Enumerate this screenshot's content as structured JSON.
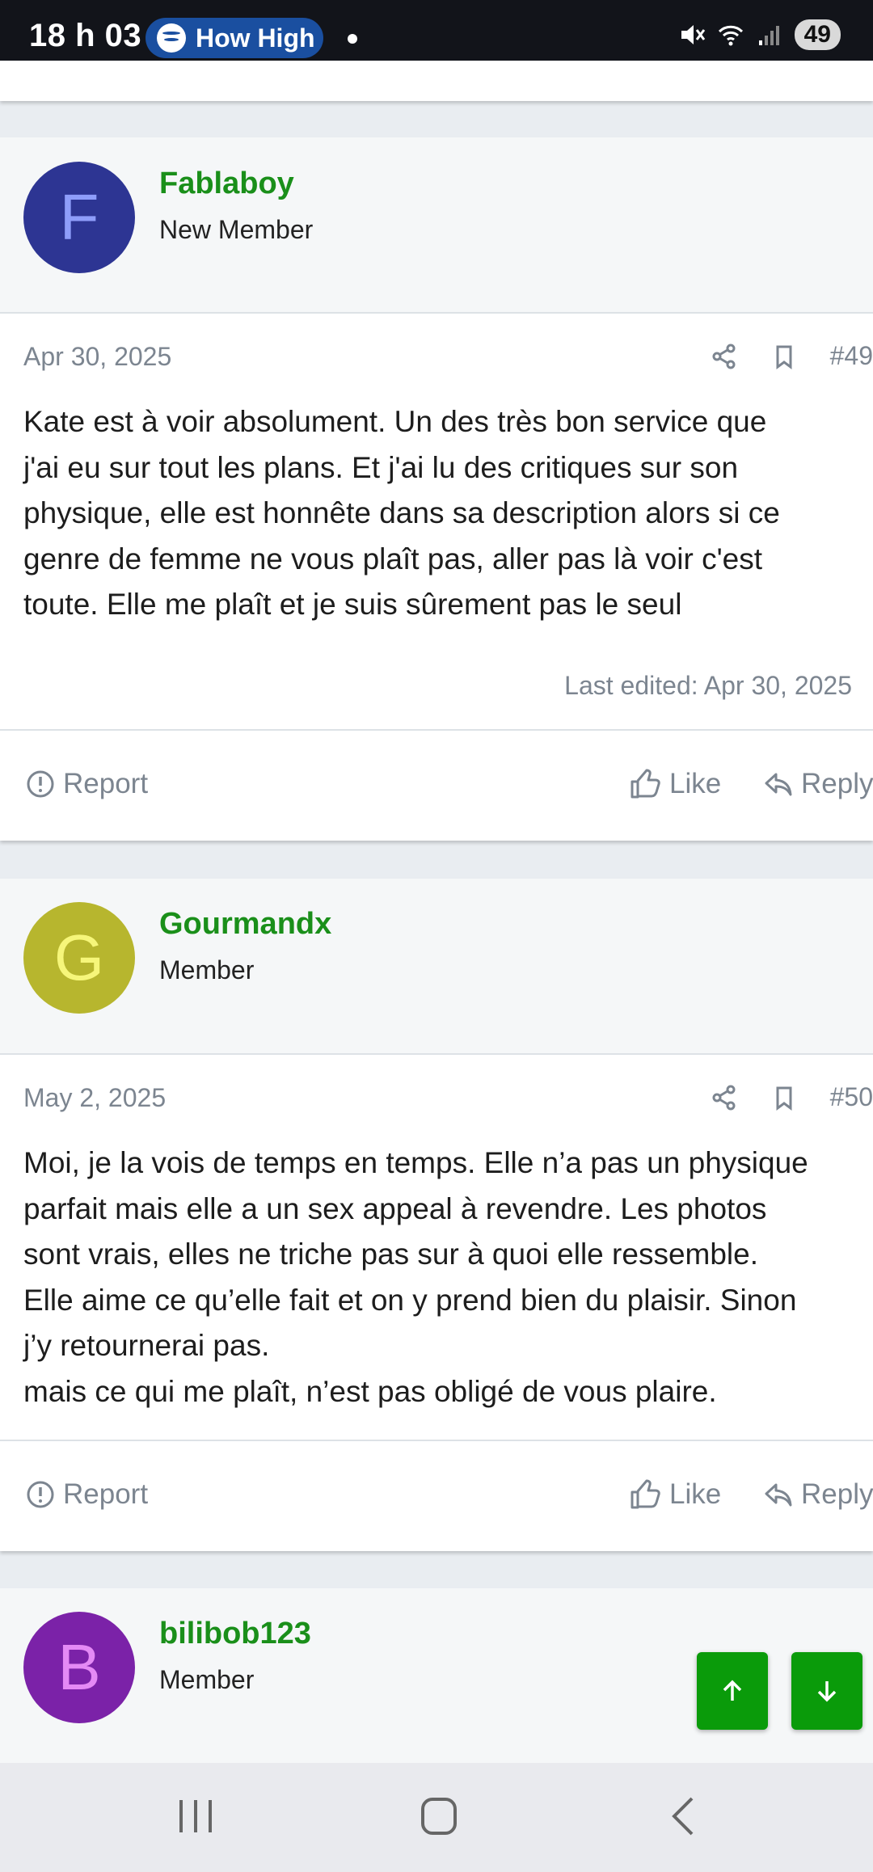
{
  "status_bar": {
    "time": "18 h 03",
    "media_pill": "How High",
    "battery": "49"
  },
  "posts": [
    {
      "avatar_letter": "F",
      "avatar_bg": "#2d3593",
      "avatar_fg": "#8e9dfa",
      "username": "Fablaboy",
      "user_title": "New Member",
      "date": "Apr 30, 2025",
      "number": "#49",
      "body": "Kate est à voir absolument. Un des très bon service que\nj'ai eu sur tout les plans. Et j'ai lu des critiques sur son\nphysique, elle est honnête dans sa description alors si ce\ngenre de femme ne vous plaît pas, aller pas là voir c'est\ntoute. Elle me plaît et je suis sûrement pas le seul",
      "last_edited": "Last edited: Apr 30, 2025"
    },
    {
      "avatar_letter": "G",
      "avatar_bg": "#b7b62e",
      "avatar_fg": "#f6f67a",
      "username": "Gourmandx",
      "user_title": "Member",
      "date": "May 2, 2025",
      "number": "#50",
      "body": "Moi, je la vois de temps en temps. Elle n’a pas un physique\nparfait mais elle a un sex appeal à revendre. Les photos\nsont vrais, elles ne triche pas sur à quoi elle ressemble.\nElle aime ce qu’elle fait et on y prend bien du plaisir. Sinon\nj’y retournerai pas.\nmais ce qui me plaît, n’est pas obligé de vous plaire."
    },
    {
      "avatar_letter": "B",
      "avatar_bg": "#7b22a8",
      "avatar_fg": "#e48af5",
      "username": "bilibob123",
      "user_title": "Member"
    }
  ],
  "actions": {
    "report": "Report",
    "like": "Like",
    "reply": "Reply"
  },
  "colors": {
    "username": "#1a8f1a",
    "accent_button": "#0a9b0a"
  }
}
